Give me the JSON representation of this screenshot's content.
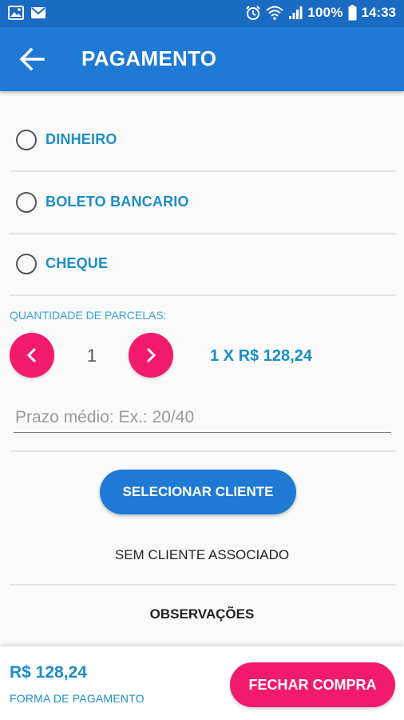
{
  "status_bar": {
    "left_icons": [
      "image-icon",
      "mail-icon"
    ],
    "right_icons": [
      "alarm-icon",
      "wifi-icon",
      "signal-icon",
      "battery-icon"
    ],
    "battery": "100%",
    "time": "14:33"
  },
  "app_bar": {
    "title": "PAGAMENTO",
    "back_icon": "arrow-left-icon"
  },
  "payment_options": [
    {
      "label": "DINHEIRO",
      "selected": false
    },
    {
      "label": "BOLETO BANCARIO",
      "selected": false
    },
    {
      "label": "CHEQUE",
      "selected": false
    }
  ],
  "installments": {
    "label": "QUANTIDADE DE PARCELAS:",
    "quantity": "1",
    "summary": "1 X R$ 128,24",
    "decrement_icon": "chevron-left-icon",
    "increment_icon": "chevron-right-icon"
  },
  "prazo": {
    "placeholder": "Prazo médio: Ex.: 20/40",
    "value": ""
  },
  "client": {
    "button_label": "SELECIONAR CLIENTE",
    "status": "SEM CLIENTE ASSOCIADO"
  },
  "observations": {
    "label": "OBSERVAÇÕES"
  },
  "footer": {
    "total": "R$ 128,24",
    "payment_form_label": "FORMA DE PAGAMENTO",
    "close_button_label": "FECHAR COMPRA"
  },
  "colors": {
    "primary": "#1f7ad6",
    "status_bar": "#1a6bc4",
    "accent": "#f21a6d",
    "text_blue": "#1a8ec7"
  }
}
